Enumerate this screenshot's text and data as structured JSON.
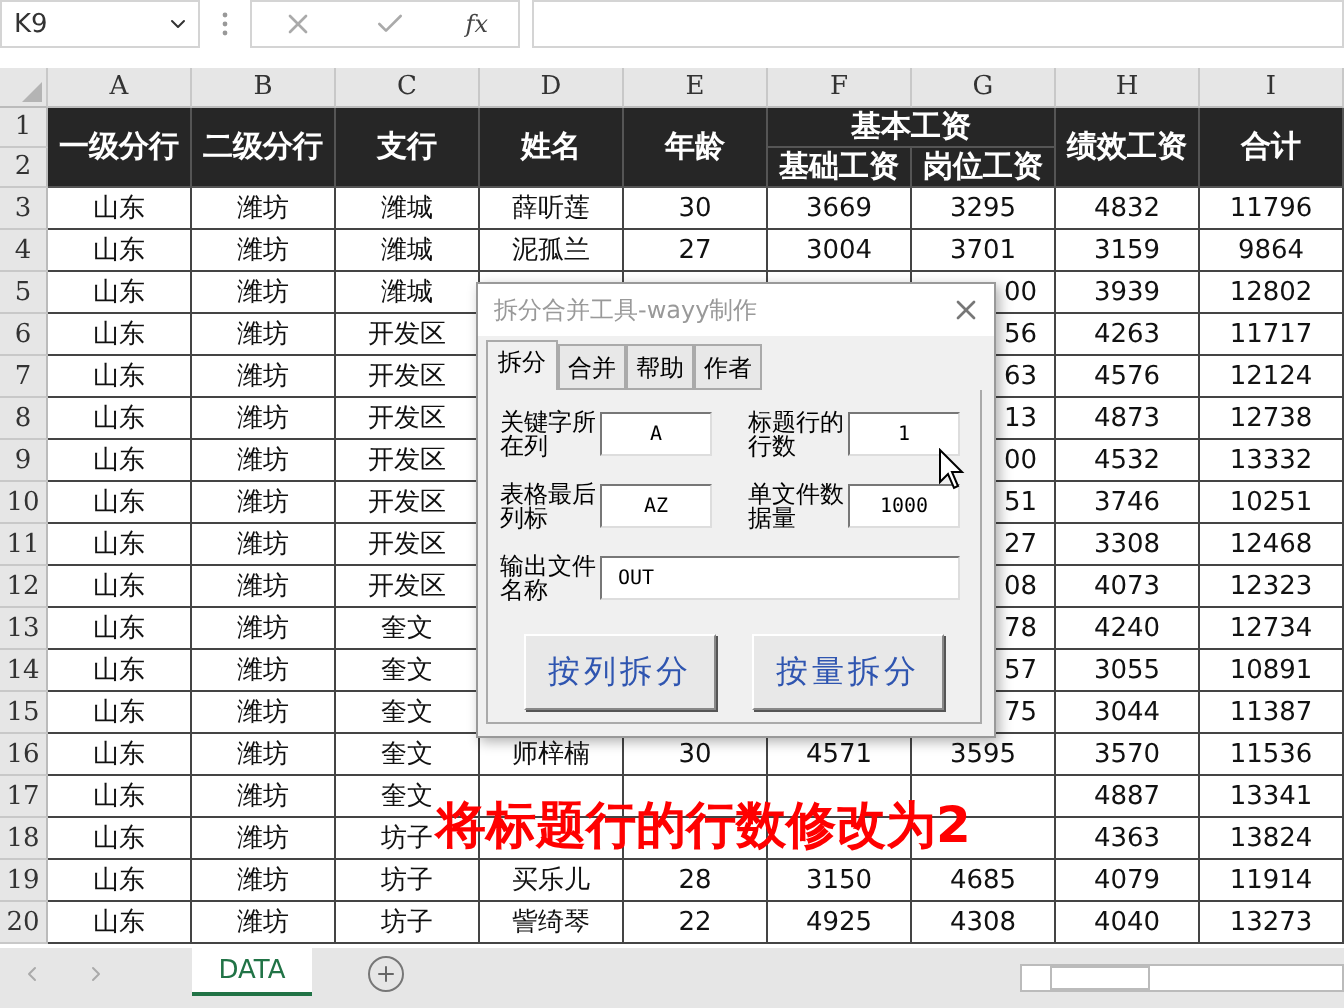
{
  "formula_bar": {
    "name_box": "K9",
    "function_label": "fx"
  },
  "column_headers": [
    "A",
    "B",
    "C",
    "D",
    "E",
    "F",
    "G",
    "H",
    "I"
  ],
  "header": {
    "row_numbers": [
      "1",
      "2"
    ],
    "columns": [
      {
        "label": "一级分行"
      },
      {
        "label": "二级分行"
      },
      {
        "label": "支行"
      },
      {
        "label": "姓名"
      },
      {
        "label": "年龄"
      },
      {
        "label": "基本工资",
        "children": [
          "基础工资",
          "岗位工资"
        ]
      },
      {
        "label": "绩效工资"
      },
      {
        "label": "合计"
      }
    ]
  },
  "rows": [
    {
      "number": "3",
      "cells": [
        "山东",
        "潍坊",
        "潍城",
        "薛听莲",
        "30",
        "3669",
        "3295",
        "4832",
        "11796"
      ]
    },
    {
      "number": "4",
      "cells": [
        "山东",
        "潍坊",
        "潍城",
        "泥孤兰",
        "27",
        "3004",
        "3701",
        "3159",
        "9864"
      ]
    },
    {
      "number": "5",
      "cells": [
        "山东",
        "潍坊",
        "潍城",
        null,
        null,
        null,
        "00",
        "3939",
        "12802"
      ]
    },
    {
      "number": "6",
      "cells": [
        "山东",
        "潍坊",
        "开发区",
        null,
        null,
        null,
        "56",
        "4263",
        "11717"
      ]
    },
    {
      "number": "7",
      "cells": [
        "山东",
        "潍坊",
        "开发区",
        null,
        null,
        null,
        "63",
        "4576",
        "12124"
      ]
    },
    {
      "number": "8",
      "cells": [
        "山东",
        "潍坊",
        "开发区",
        null,
        null,
        null,
        "13",
        "4873",
        "12738"
      ]
    },
    {
      "number": "9",
      "cells": [
        "山东",
        "潍坊",
        "开发区",
        null,
        null,
        null,
        "00",
        "4532",
        "13332"
      ]
    },
    {
      "number": "10",
      "cells": [
        "山东",
        "潍坊",
        "开发区",
        null,
        null,
        null,
        "51",
        "3746",
        "10251"
      ]
    },
    {
      "number": "11",
      "cells": [
        "山东",
        "潍坊",
        "开发区",
        null,
        null,
        null,
        "27",
        "3308",
        "12468"
      ]
    },
    {
      "number": "12",
      "cells": [
        "山东",
        "潍坊",
        "开发区",
        null,
        null,
        null,
        "08",
        "4073",
        "12323"
      ]
    },
    {
      "number": "13",
      "cells": [
        "山东",
        "潍坊",
        "奎文",
        null,
        null,
        null,
        "78",
        "4240",
        "12734"
      ]
    },
    {
      "number": "14",
      "cells": [
        "山东",
        "潍坊",
        "奎文",
        null,
        null,
        null,
        "57",
        "3055",
        "10891"
      ]
    },
    {
      "number": "15",
      "cells": [
        "山东",
        "潍坊",
        "奎文",
        null,
        null,
        null,
        "75",
        "3044",
        "11387"
      ]
    },
    {
      "number": "16",
      "cells": [
        "山东",
        "潍坊",
        "奎文",
        "师梓楠",
        "30",
        "4571",
        "3595",
        "3570",
        "11536"
      ]
    },
    {
      "number": "17",
      "cells": [
        "山东",
        "潍坊",
        "奎文",
        null,
        null,
        null,
        null,
        "4887",
        "13341"
      ]
    },
    {
      "number": "18",
      "cells": [
        "山东",
        "潍坊",
        "坊子",
        null,
        null,
        null,
        null,
        "4363",
        "13824"
      ]
    },
    {
      "number": "19",
      "cells": [
        "山东",
        "潍坊",
        "坊子",
        "买乐儿",
        "28",
        "3150",
        "4685",
        "4079",
        "11914"
      ]
    },
    {
      "number": "20",
      "cells": [
        "山东",
        "潍坊",
        "坊子",
        "訾绮琴",
        "22",
        "4925",
        "4308",
        "4040",
        "13273"
      ]
    }
  ],
  "dialog": {
    "title": "拆分合并工具-wayy制作",
    "tabs": [
      {
        "label": "拆分",
        "selected": true
      },
      {
        "label": "合并",
        "selected": false
      },
      {
        "label": "帮助",
        "selected": false
      },
      {
        "label": "作者",
        "selected": false
      }
    ],
    "fields": [
      {
        "label": "关键字所在列",
        "value": "A"
      },
      {
        "label": "标题行的行数",
        "value": "1"
      },
      {
        "label": "表格最后列标",
        "value": "AZ"
      },
      {
        "label": "单文件数据量",
        "value": "1000"
      }
    ],
    "output": {
      "label": "输出文件名称",
      "value": "OUT"
    },
    "buttons": [
      "按列拆分",
      "按量拆分"
    ]
  },
  "annotation": "将标题行的行数修改为2",
  "sheet_tabs": [
    {
      "label": "DATA",
      "selected": true
    }
  ]
}
